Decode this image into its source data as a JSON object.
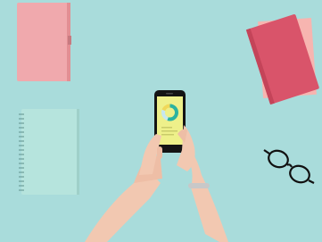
{
  "scene": {
    "background_color": "#a9dcdb",
    "objects": [
      {
        "name": "pink-notebook",
        "color": "#f0a9ad"
      },
      {
        "name": "spiral-notebook",
        "color": "#b6e4dd"
      },
      {
        "name": "red-book",
        "color": "#d9546a"
      },
      {
        "name": "pink-book-under",
        "color": "#f7b5b0"
      },
      {
        "name": "eyeglasses",
        "color": "#111111"
      },
      {
        "name": "smartphone",
        "color": "#141414"
      }
    ],
    "phone_screen": {
      "background_color": "#eef08a",
      "donut_chart": {
        "segments": [
          {
            "color": "#2bb3a0",
            "fraction": 0.55
          },
          {
            "color": "#c7e7ef",
            "fraction": 0.25
          },
          {
            "color": "#f0d85a",
            "fraction": 0.2
          }
        ]
      }
    }
  }
}
